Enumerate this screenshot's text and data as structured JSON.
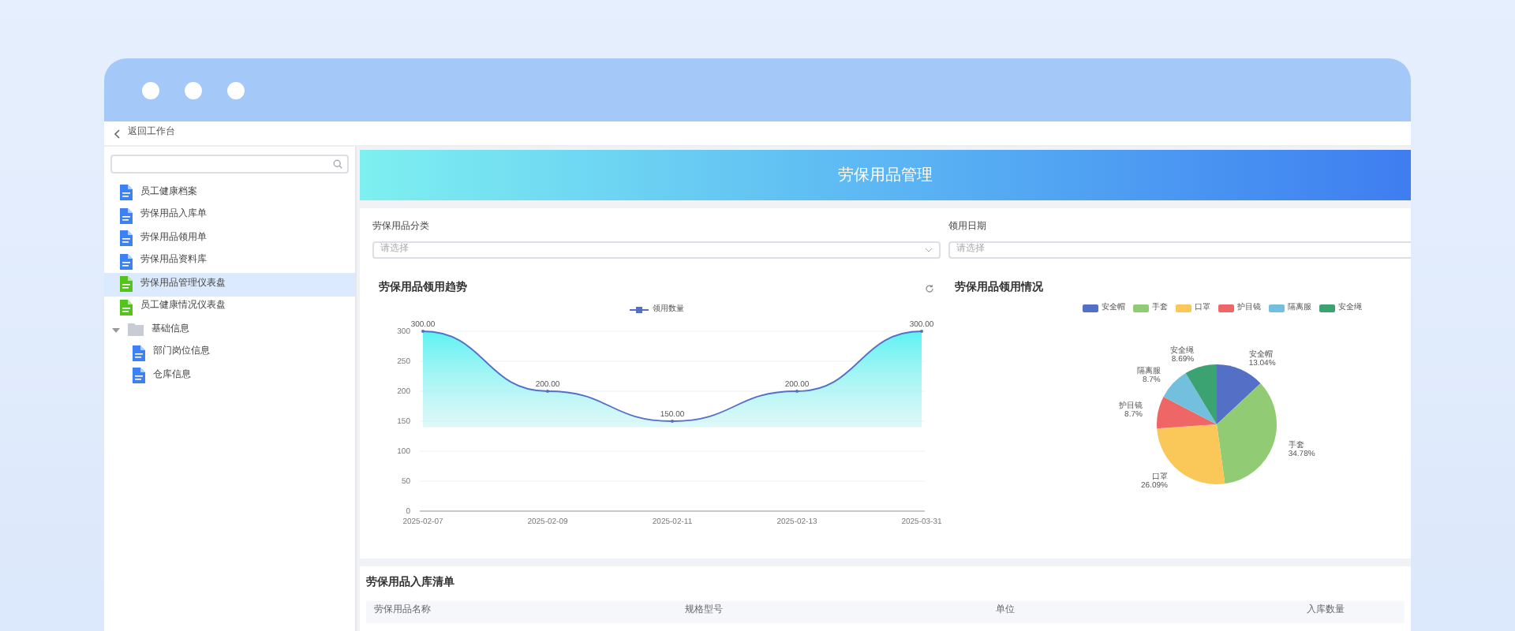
{
  "nav": {
    "back": "返回工作台"
  },
  "sidebar": {
    "items": [
      {
        "label": "员工健康档案",
        "kind": "doc",
        "selected": false
      },
      {
        "label": "劳保用品入库单",
        "kind": "doc",
        "selected": false
      },
      {
        "label": "劳保用品领用单",
        "kind": "doc",
        "selected": false
      },
      {
        "label": "劳保用品资料库",
        "kind": "doc",
        "selected": false
      },
      {
        "label": "劳保用品管理仪表盘",
        "kind": "dashboard",
        "selected": true
      },
      {
        "label": "员工健康情况仪表盘",
        "kind": "dashboard",
        "selected": false
      },
      {
        "label": "基础信息",
        "kind": "folder",
        "selected": false,
        "expanded": true,
        "children": [
          {
            "label": "部门岗位信息",
            "kind": "doc",
            "selected": false
          },
          {
            "label": "仓库信息",
            "kind": "doc",
            "selected": false
          }
        ]
      }
    ]
  },
  "banner": {
    "title": "劳保用品管理"
  },
  "filters": [
    {
      "label": "劳保用品分类",
      "placeholder": "请选择",
      "kind": "select"
    },
    {
      "label": "领用日期",
      "placeholder": "请选择",
      "kind": "date"
    }
  ],
  "trend": {
    "title": "劳保用品领用趋势",
    "chart_data": {
      "type": "line",
      "categories": [
        "2025-02-07",
        "2025-02-09",
        "2025-02-11",
        "2025-02-13",
        "2025-03-31"
      ],
      "series": [
        {
          "name": "领用数量",
          "color": "#5470c6",
          "values": [
            300,
            200,
            150,
            200,
            300
          ]
        }
      ],
      "ylim": [
        0,
        300
      ],
      "yticks": [
        0,
        50,
        100,
        150,
        200,
        250,
        300
      ],
      "grid": true,
      "value_labels": [
        "300.00",
        "200.00",
        "150.00",
        "200.00",
        "300.00"
      ]
    }
  },
  "usage": {
    "title": "劳保用品领用情况",
    "chart_data": {
      "type": "pie",
      "categories": [
        "安全帽",
        "手套",
        "口罩",
        "护目镜",
        "隔离服",
        "安全绳"
      ],
      "values": [
        13.04,
        34.78,
        26.09,
        8.7,
        8.7,
        8.69
      ],
      "colors": [
        "#5470c6",
        "#91cc75",
        "#fac858",
        "#ee6666",
        "#73c0de",
        "#3ba272"
      ],
      "value_labels": [
        "13.04%",
        "34.78%",
        "26.09%",
        "8.7%",
        "8.7%",
        "8.69%"
      ]
    }
  },
  "table": {
    "title": "劳保用品入库清单",
    "columns": [
      "劳保用品名称",
      "规格型号",
      "单位",
      "入库数量"
    ]
  }
}
